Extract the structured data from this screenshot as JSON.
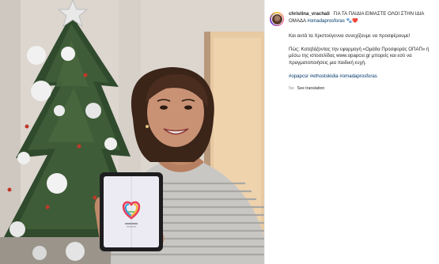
{
  "post": {
    "username": "christina_vrachali",
    "headline": "ΓΙΑ ΤΑ ΠΑΙΔΙΑ ΕΙΜΑΣΤΕ ΟΛΟΙ ΣΤΗΝ ΙΔΙΑ ΟΜΑΔΑ",
    "headline_tag": "#omadaprosforas",
    "headline_emoji": "🐾❤️",
    "para1": "Και αυτά τα Χριστούγεννα συνεχίζουμε να προσφέρουμε!",
    "para2": "Πώς; Κατεβάζοντας την εφαρμογή «Ομάδα Προσφοράς ΟΠΑΠ» ή μέσω της ιστοσελίδας www.opapcsr.gr μπορείς και εσύ να πραγματοποιήσεις μια παιδική ευχή.",
    "hashtags": "#opapcsr #ethostokidia #omadaprosforas",
    "time_ago": "5w",
    "see_translation": "See translation"
  },
  "colors": {
    "link": "#00376b",
    "text": "#262626",
    "muted": "#8e8e8e"
  }
}
